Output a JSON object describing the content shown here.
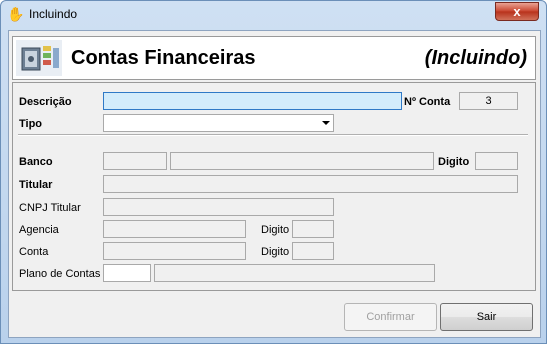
{
  "window": {
    "title": "Incluindo",
    "close_label": "x"
  },
  "header": {
    "title": "Contas Financeiras",
    "status": "(Incluindo)"
  },
  "form": {
    "descricao_label": "Descrição",
    "descricao_value": "",
    "num_conta_label": "Nº Conta",
    "num_conta_value": "3",
    "tipo_label": "Tipo",
    "tipo_value": "",
    "banco_label": "Banco",
    "digito_banco_label": "Digito",
    "titular_label": "Titular",
    "cnpj_titular_label": "CNPJ Titular",
    "agencia_label": "Agencia",
    "digito_agencia_label": "Digito",
    "conta_label": "Conta",
    "digito_conta_label": "Digito",
    "plano_de_contas_label": "Plano de Contas"
  },
  "buttons": {
    "confirmar": "Confirmar",
    "sair": "Sair"
  },
  "icons": {
    "window_icon": "hand-icon",
    "logo": "finance-accounts-icon"
  }
}
